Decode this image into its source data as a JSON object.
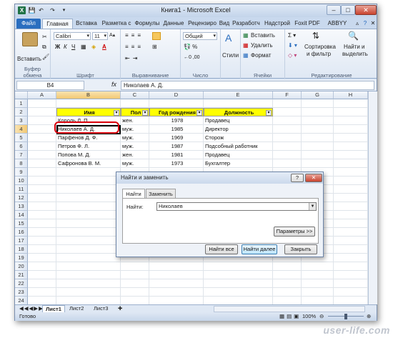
{
  "window": {
    "title": "Книга1 - Microsoft Excel"
  },
  "quick_access": [
    "save-icon",
    "undo-icon",
    "redo-icon"
  ],
  "tabs": [
    "Файл",
    "Главная",
    "Вставка",
    "Разметка с",
    "Формулы",
    "Данные",
    "Рецензиро",
    "Вид",
    "Разработч",
    "Надстрой",
    "Foxit PDF",
    "ABBYY PDF"
  ],
  "ribbon": {
    "paste_label": "Вставить",
    "clipboard": "Буфер обмена",
    "font_name": "Calibri",
    "font_size": "11",
    "font_group": "Шрифт",
    "align_group": "Выравнивание",
    "number_format": "Общий",
    "number_group": "Число",
    "styles_label": "Стили",
    "insert_label": "Вставить",
    "delete_label": "Удалить",
    "format_label": "Формат",
    "cells_group": "Ячейки",
    "sort_label1": "Сортировка",
    "sort_label2": "и фильтр",
    "find_label1": "Найти и",
    "find_label2": "выделить",
    "edit_group": "Редактирование",
    "bold": "Ж",
    "italic": "К",
    "underline": "Ч"
  },
  "formula_bar": {
    "name_box": "B4",
    "fx": "fx",
    "value": "Николаев А. Д."
  },
  "columns": [
    "A",
    "B",
    "C",
    "D",
    "E",
    "F",
    "G",
    "H"
  ],
  "rows": [
    "1",
    "2",
    "3",
    "4",
    "5",
    "6",
    "7",
    "8",
    "9",
    "10",
    "11",
    "12",
    "13",
    "14",
    "15",
    "16",
    "17",
    "18",
    "19",
    "20",
    "21",
    "22",
    "23",
    "24"
  ],
  "table": {
    "headers": [
      "Имя",
      "Пол",
      "Год рождения",
      "Должность"
    ],
    "rows": [
      [
        "Король Л. П.",
        "жен.",
        "1978",
        "Продавец"
      ],
      [
        "Николаев А. Д.",
        "муж.",
        "1985",
        "Директор"
      ],
      [
        "Парфенов Д. Ф.",
        "муж.",
        "1969",
        "Сторож"
      ],
      [
        "Петров Ф. Л.",
        "муж.",
        "1987",
        "Подсобный работник"
      ],
      [
        "Попова М. Д.",
        "жен.",
        "1981",
        "Продавец"
      ],
      [
        "Сафронова В. М.",
        "муж.",
        "1973",
        "Бухгалтер"
      ]
    ]
  },
  "sheets": [
    "Лист1",
    "Лист2",
    "Лист3"
  ],
  "status": {
    "ready": "Готово",
    "zoom": "100%"
  },
  "dialog": {
    "title": "Найти и заменить",
    "help": "?",
    "close": "✕",
    "tab_find": "Найти",
    "tab_replace": "Заменить",
    "find_label": "Найти:",
    "find_value": "Николаев",
    "params": "Параметры >>",
    "find_all": "Найти все",
    "find_next": "Найти далее",
    "close_btn": "Закрыть"
  },
  "watermark": "user-life.com"
}
